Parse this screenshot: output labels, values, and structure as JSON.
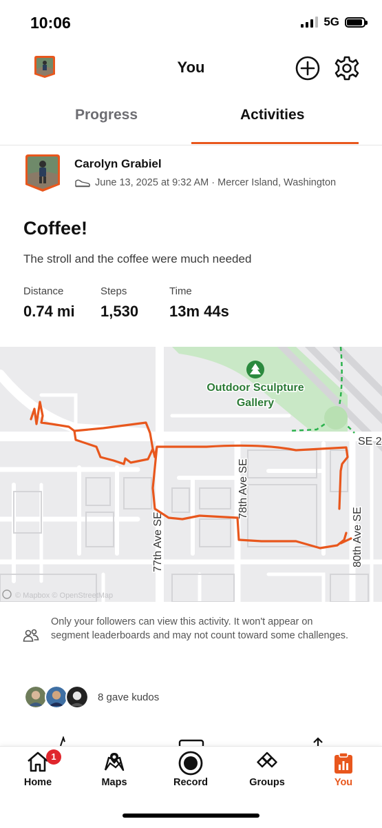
{
  "status_bar": {
    "time": "10:06",
    "network": "5G"
  },
  "header": {
    "title": "You"
  },
  "tabs": [
    {
      "label": "Progress",
      "active": false
    },
    {
      "label": "Activities",
      "active": true
    }
  ],
  "activity": {
    "athlete_name": "Carolyn Grabiel",
    "meta": "June 13, 2025 at 9:32 AM · Mercer Island, Washington",
    "title": "Coffee!",
    "description": "The stroll and the coffee were much needed",
    "stats": [
      {
        "label": "Distance",
        "value": "0.74 mi"
      },
      {
        "label": "Steps",
        "value": "1,530"
      },
      {
        "label": "Time",
        "value": "13m 44s"
      }
    ]
  },
  "map": {
    "poi_name_line1": "Outdoor Sculpture",
    "poi_name_line2": "Gallery",
    "streets": [
      "77th Ave SE",
      "78th Ave SE",
      "80th Ave SE",
      "SE 2"
    ],
    "attribution": "© Mapbox © OpenStreetMap",
    "route_color": "#e8571d",
    "park_color": "#c9e8c6",
    "trail_color": "#2bb24c"
  },
  "privacy_notice": "Only your followers can view this activity. It won't appear on segment leaderboards and may not count toward some challenges.",
  "kudos": {
    "text": "8 gave kudos"
  },
  "bottom_nav": [
    {
      "label": "Home",
      "icon": "home-icon",
      "badge": "1",
      "active": false
    },
    {
      "label": "Maps",
      "icon": "map-icon",
      "active": false
    },
    {
      "label": "Record",
      "icon": "record-icon",
      "active": false
    },
    {
      "label": "Groups",
      "icon": "groups-icon",
      "active": false
    },
    {
      "label": "You",
      "icon": "you-icon",
      "active": true
    }
  ],
  "accent_color": "#e8571d"
}
